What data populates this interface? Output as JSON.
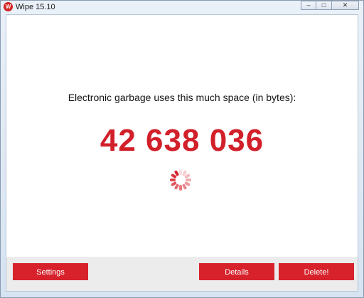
{
  "window": {
    "title": "Wipe 15.10",
    "icon_letter": "W",
    "controls": [
      "minimize",
      "maximize",
      "close"
    ]
  },
  "main": {
    "headline": "Electronic garbage uses this much space (in bytes):",
    "bytes_value": "42 638 036",
    "spinner": "loading-spinner-icon"
  },
  "footer": {
    "settings_label": "Settings",
    "details_label": "Details",
    "delete_label": "Delete!"
  },
  "colors": {
    "accent": "#d7222c",
    "counter": "#d2202b"
  }
}
